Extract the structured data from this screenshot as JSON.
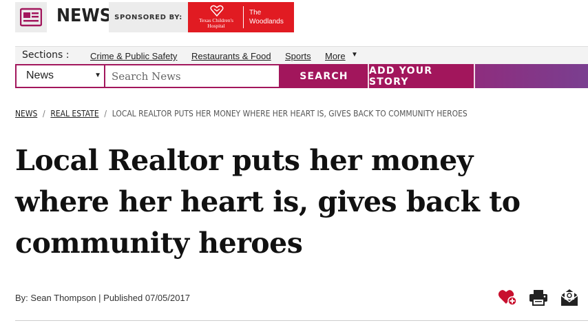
{
  "header": {
    "logo_icon": "newspaper-icon",
    "title": "NEWS",
    "sponsored_by": "SPONSORED BY:",
    "sponsor": {
      "name": "Texas Children's Hospital",
      "location_line1": "The",
      "location_line2": "Woodlands",
      "icon": "hospital-heart-logo",
      "color": "#e11b22"
    }
  },
  "sections": {
    "label": "Sections :",
    "links": [
      "Crime & Public Safety",
      "Restaurants & Food",
      "Sports",
      "More"
    ]
  },
  "search": {
    "category_selected": "News",
    "placeholder": "Search News",
    "search_button": "SEARCH",
    "add_story_button": "ADD YOUR STORY",
    "accent_color": "#a2165c"
  },
  "breadcrumb": {
    "items": [
      "NEWS",
      "REAL ESTATE"
    ],
    "current": "LOCAL REALTOR PUTS HER MONEY WHERE HER HEART IS, GIVES BACK TO COMMUNITY HEROES",
    "separator": "/"
  },
  "article": {
    "headline": "Local Realtor puts her money where her heart is, gives back to community heroes",
    "byline": "By: Sean Thompson | Published 07/05/2017"
  },
  "actions": [
    {
      "name": "favorite-heart-icon",
      "color": "#c8102e"
    },
    {
      "name": "print-icon",
      "color": "#222222"
    },
    {
      "name": "email-icon",
      "color": "#222222"
    }
  ]
}
